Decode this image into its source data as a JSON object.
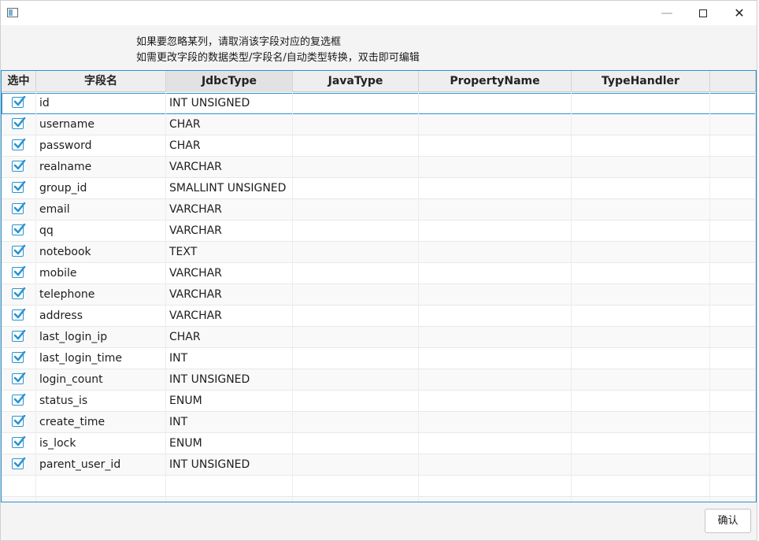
{
  "window": {
    "minimize_glyph": "—",
    "close_glyph": "✕"
  },
  "hints": {
    "line1": "如果要忽略某列，请取消该字段对应的复选框",
    "line2": "如需更改字段的数据类型/字段名/自动类型转换，双击即可编辑"
  },
  "table": {
    "columns": [
      "选中",
      "字段名",
      "JdbcType",
      "JavaType",
      "PropertyName",
      "TypeHandler"
    ],
    "rows": [
      {
        "checked": true,
        "field": "id",
        "jdbc": "INT UNSIGNED",
        "java": "",
        "property": "",
        "handler": ""
      },
      {
        "checked": true,
        "field": "username",
        "jdbc": "CHAR",
        "java": "",
        "property": "",
        "handler": ""
      },
      {
        "checked": true,
        "field": "password",
        "jdbc": "CHAR",
        "java": "",
        "property": "",
        "handler": ""
      },
      {
        "checked": true,
        "field": "realname",
        "jdbc": "VARCHAR",
        "java": "",
        "property": "",
        "handler": ""
      },
      {
        "checked": true,
        "field": "group_id",
        "jdbc": "SMALLINT UNSIGNED",
        "java": "",
        "property": "",
        "handler": ""
      },
      {
        "checked": true,
        "field": "email",
        "jdbc": "VARCHAR",
        "java": "",
        "property": "",
        "handler": ""
      },
      {
        "checked": true,
        "field": "qq",
        "jdbc": "VARCHAR",
        "java": "",
        "property": "",
        "handler": ""
      },
      {
        "checked": true,
        "field": "notebook",
        "jdbc": "TEXT",
        "java": "",
        "property": "",
        "handler": ""
      },
      {
        "checked": true,
        "field": "mobile",
        "jdbc": "VARCHAR",
        "java": "",
        "property": "",
        "handler": ""
      },
      {
        "checked": true,
        "field": "telephone",
        "jdbc": "VARCHAR",
        "java": "",
        "property": "",
        "handler": ""
      },
      {
        "checked": true,
        "field": "address",
        "jdbc": "VARCHAR",
        "java": "",
        "property": "",
        "handler": ""
      },
      {
        "checked": true,
        "field": "last_login_ip",
        "jdbc": "CHAR",
        "java": "",
        "property": "",
        "handler": ""
      },
      {
        "checked": true,
        "field": "last_login_time",
        "jdbc": "INT",
        "java": "",
        "property": "",
        "handler": ""
      },
      {
        "checked": true,
        "field": "login_count",
        "jdbc": "INT UNSIGNED",
        "java": "",
        "property": "",
        "handler": ""
      },
      {
        "checked": true,
        "field": "status_is",
        "jdbc": "ENUM",
        "java": "",
        "property": "",
        "handler": ""
      },
      {
        "checked": true,
        "field": "create_time",
        "jdbc": "INT",
        "java": "",
        "property": "",
        "handler": ""
      },
      {
        "checked": true,
        "field": "is_lock",
        "jdbc": "ENUM",
        "java": "",
        "property": "",
        "handler": ""
      },
      {
        "checked": true,
        "field": "parent_user_id",
        "jdbc": "INT UNSIGNED",
        "java": "",
        "property": "",
        "handler": ""
      }
    ]
  },
  "footer": {
    "confirm_label": "确认"
  },
  "colors": {
    "accent": "#2a93d1",
    "header_bg": "#eeeeee"
  }
}
